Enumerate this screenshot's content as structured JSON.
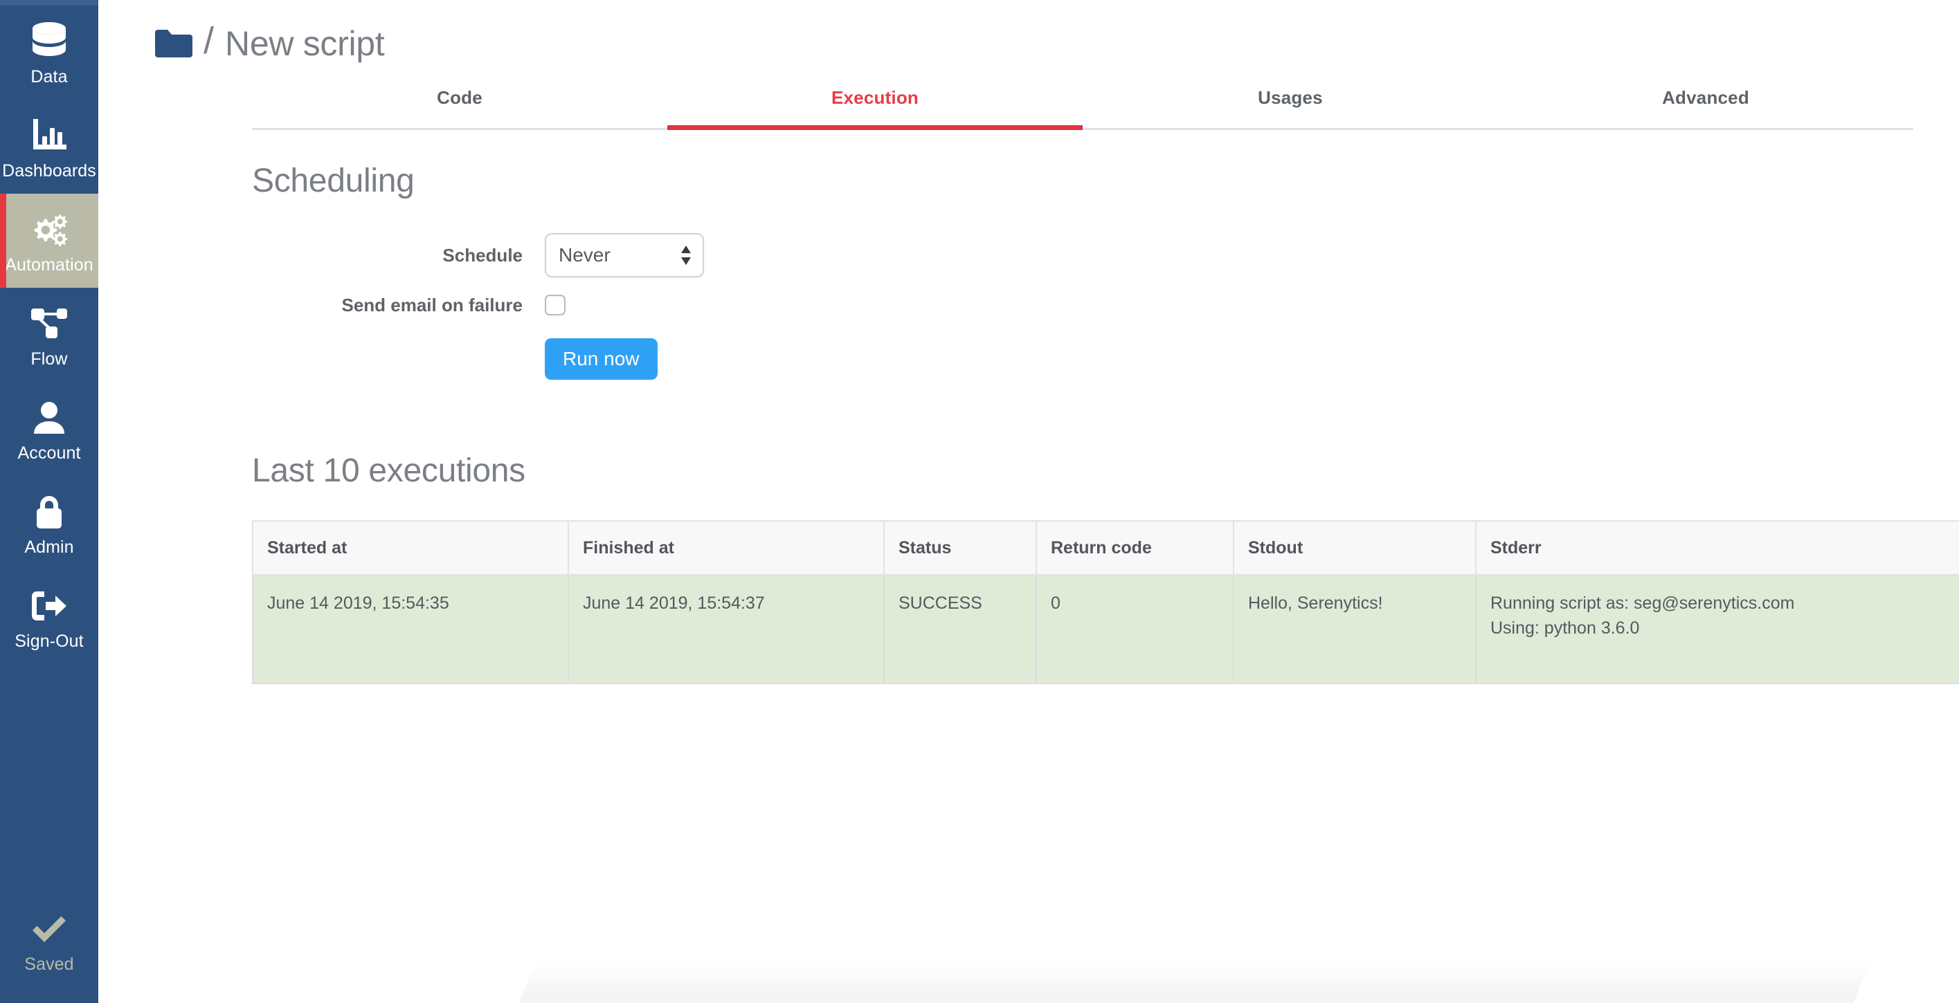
{
  "sidebar": {
    "items": [
      {
        "label": "Data",
        "icon": "database-icon",
        "active": false
      },
      {
        "label": "Dashboards",
        "icon": "bar-chart-icon",
        "active": false
      },
      {
        "label": "Automation",
        "icon": "gears-icon",
        "active": true
      },
      {
        "label": "Flow",
        "icon": "flow-icon",
        "active": false
      },
      {
        "label": "Account",
        "icon": "user-icon",
        "active": false
      },
      {
        "label": "Admin",
        "icon": "lock-icon",
        "active": false
      },
      {
        "label": "Sign-Out",
        "icon": "sign-out-icon",
        "active": false
      }
    ],
    "status": {
      "label": "Saved",
      "icon": "check-icon"
    },
    "colors": {
      "background": "#2d517f",
      "active_background": "#b9bba8",
      "active_accent": "#e53943",
      "status_color": "#b9bba8"
    }
  },
  "breadcrumb": {
    "folder_icon": "folder-icon",
    "separator": "/",
    "title": "New script"
  },
  "tabs": [
    {
      "label": "Code",
      "active": false
    },
    {
      "label": "Execution",
      "active": true
    },
    {
      "label": "Usages",
      "active": false
    },
    {
      "label": "Advanced",
      "active": false
    }
  ],
  "tab_accent": "#e0343f",
  "scheduling": {
    "heading": "Scheduling",
    "schedule_label": "Schedule",
    "schedule_value": "Never",
    "schedule_options": [
      "Never"
    ],
    "email_label": "Send email on failure",
    "email_checked": false,
    "run_now_label": "Run now",
    "run_now_color": "#2fa1f5"
  },
  "executions": {
    "heading": "Last 10 executions",
    "columns": [
      "Started at",
      "Finished at",
      "Status",
      "Return code",
      "Stdout",
      "Stderr"
    ],
    "rows": [
      {
        "started_at": "June 14 2019, 15:54:35",
        "finished_at": "June 14 2019, 15:54:37",
        "status": "SUCCESS",
        "return_code": "0",
        "stdout": "Hello, Serenytics!",
        "stderr_line1": "Running script as: seg@serenytics.com",
        "stderr_line2": "Using: python 3.6.0"
      }
    ],
    "row_success_color": "#dfebd7"
  }
}
